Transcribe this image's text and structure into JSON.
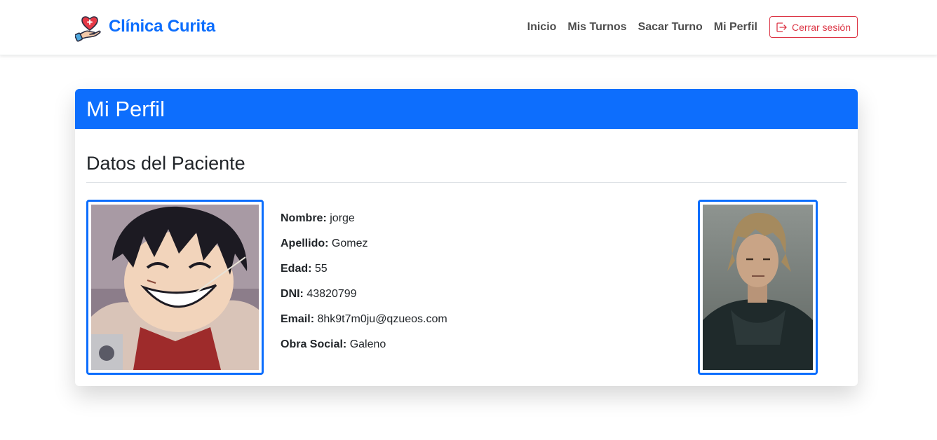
{
  "brand": {
    "name": "Clínica Curita",
    "logo_icon": "heart-hand-icon"
  },
  "nav": {
    "links": [
      "Inicio",
      "Mis Turnos",
      "Sacar Turno",
      "Mi Perfil"
    ],
    "logout_label": "Cerrar sesión",
    "logout_icon": "logout-icon"
  },
  "page": {
    "title": "Mi Perfil",
    "section_title": "Datos del Paciente"
  },
  "patient": {
    "fields": [
      {
        "label": "Nombre:",
        "value": "jorge"
      },
      {
        "label": "Apellido:",
        "value": "Gomez"
      },
      {
        "label": "Edad:",
        "value": "55"
      },
      {
        "label": "DNI:",
        "value": "43820799"
      },
      {
        "label": "Email:",
        "value": "8hk9t7m0ju@qzueos.com"
      },
      {
        "label": "Obra Social:",
        "value": "Galeno"
      }
    ],
    "photo_main": "patient-photo-anime",
    "photo_secondary": "patient-photo-portrait"
  },
  "colors": {
    "primary": "#0d6efd",
    "danger": "#dc3545",
    "nav_text": "#4d4d4d"
  }
}
